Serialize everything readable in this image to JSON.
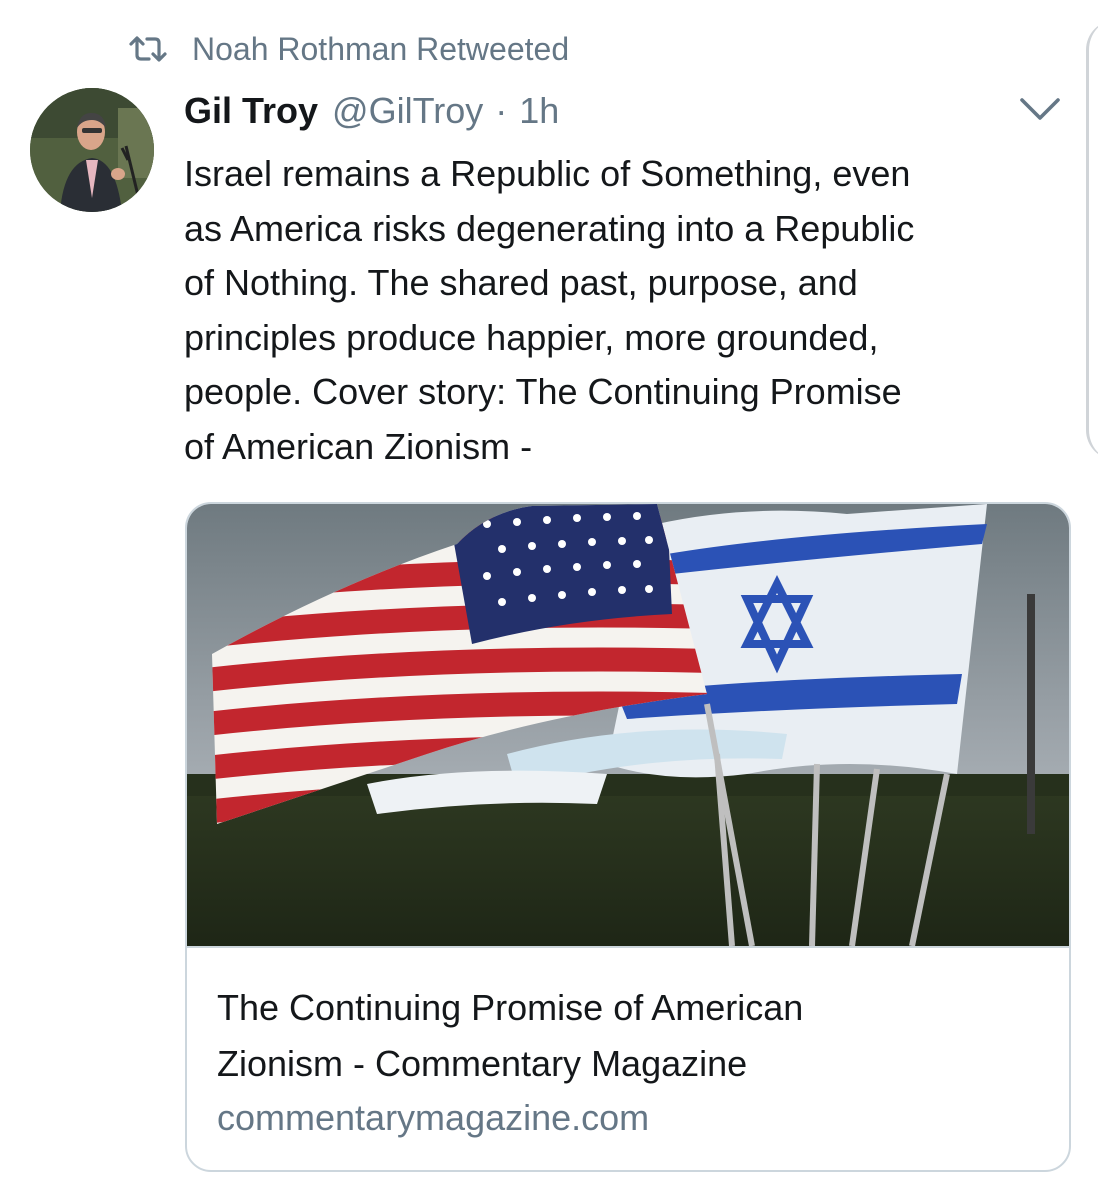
{
  "retweet": {
    "icon": "retweet-icon",
    "text": "Noah Rothman Retweeted"
  },
  "tweet": {
    "avatar": "avatar-photo",
    "display_name": "Gil Troy",
    "handle": "@GilTroy",
    "separator": "·",
    "time": "1h",
    "menu_icon": "chevron-down-icon",
    "text_lines": [
      "Israel remains a Republic of Something, even",
      "as America risks degenerating into a Republic",
      "of Nothing. The shared past, purpose, and",
      "principles produce happier, more grounded,",
      "people. Cover story: The Continuing Promise",
      "of American Zionism -"
    ]
  },
  "card": {
    "image": "american-and-israeli-flags-photo",
    "title_lines": [
      "The Continuing Promise of American",
      "Zionism - Commentary Magazine"
    ],
    "domain": "commentarymagazine.com"
  },
  "colors": {
    "text_primary": "#14171a",
    "text_secondary": "#657786",
    "border": "#ccd6dd",
    "background": "#ffffff"
  }
}
